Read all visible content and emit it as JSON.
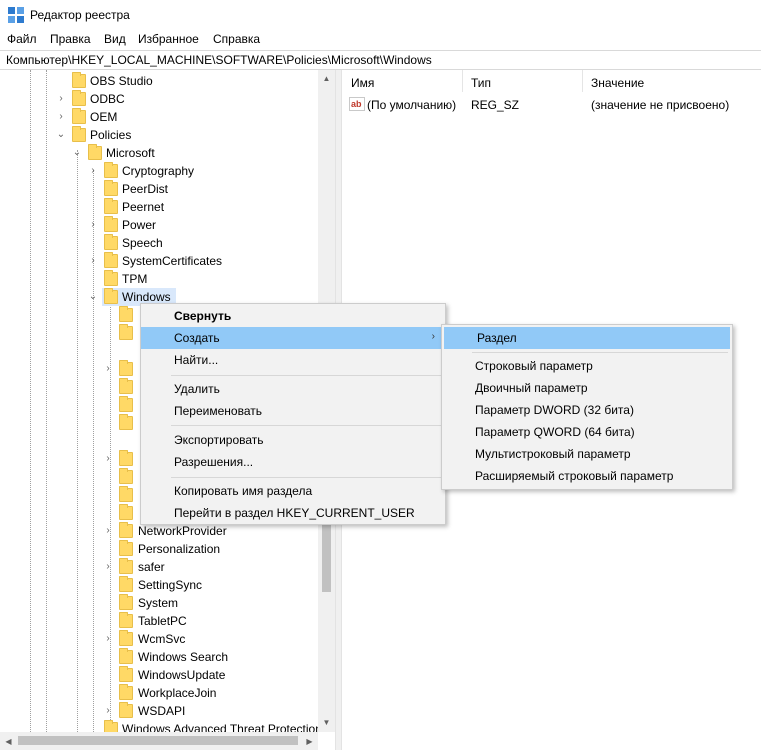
{
  "window": {
    "title": "Редактор реестра"
  },
  "menubar": {
    "items": [
      "Файл",
      "Правка",
      "Вид",
      "Избранное",
      "Справка"
    ]
  },
  "address": {
    "path": "Компьютер\\HKEY_LOCAL_MACHINE\\SOFTWARE\\Policies\\Microsoft\\Windows"
  },
  "tree": {
    "level1": [
      "OBS Studio",
      "ODBC",
      "OEM",
      "Policies"
    ],
    "microsoft": "Microsoft",
    "level3": [
      "Cryptography",
      "PeerDist",
      "Peernet",
      "Power",
      "Speech",
      "SystemCertificates",
      "TPM",
      "Windows"
    ],
    "level4_visible": [
      "NetworkProvider",
      "Personalization",
      "safer",
      "SettingSync",
      "System",
      "TabletPC",
      "WcmSvc",
      "Windows Search",
      "WindowsUpdate",
      "WorkplaceJoin",
      "WSDAPI"
    ],
    "after": "Windows Advanced Threat Protection"
  },
  "values": {
    "headers": {
      "name": "Имя",
      "type": "Тип",
      "data": "Значение"
    },
    "rows": [
      {
        "name": "(По умолчанию)",
        "type": "REG_SZ",
        "data": "(значение не присвоено)",
        "icon": "ab"
      }
    ]
  },
  "context_menu": {
    "items": [
      "Свернуть",
      "Создать",
      "Найти...",
      "Удалить",
      "Переименовать",
      "Экспортировать",
      "Разрешения...",
      "Копировать имя раздела",
      "Перейти в раздел HKEY_CURRENT_USER"
    ],
    "highlighted": "Создать"
  },
  "submenu": {
    "items": [
      "Раздел",
      "Строковый параметр",
      "Двоичный параметр",
      "Параметр DWORD (32 бита)",
      "Параметр QWORD (64 бита)",
      "Мультистроковый параметр",
      "Расширяемый строковый параметр"
    ],
    "highlighted": "Раздел"
  },
  "colors": {
    "highlight": "#91c9f7",
    "folder": "#ffd966",
    "selection": "#d9e8fb"
  }
}
